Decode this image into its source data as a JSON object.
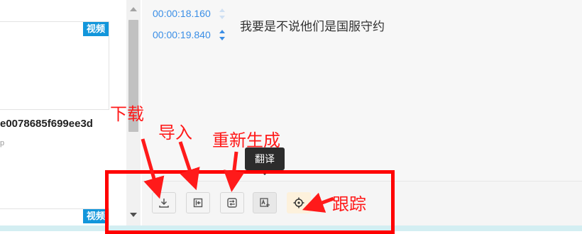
{
  "media_list": {
    "badge": "视频",
    "file_name": "e0078685f699ee3d",
    "sub_text": "p",
    "badge_bottom": "视频"
  },
  "subtitle": {
    "start_time": "00:00:18.160",
    "end_time": "00:00:19.840",
    "text": "我要是不说他们是国服守约"
  },
  "toolbar": {
    "tooltip": "翻译",
    "buttons": [
      {
        "icon": "download-icon"
      },
      {
        "icon": "import-icon"
      },
      {
        "icon": "regenerate-icon"
      },
      {
        "icon": "translate-icon"
      },
      {
        "icon": "target-icon"
      }
    ]
  },
  "annotations": {
    "download": "下载",
    "import": "导入",
    "regenerate": "重新生成",
    "track": "跟踪",
    "box_color": "#ff0000"
  },
  "colors": {
    "accent": "#3a8ee6",
    "badge": "#1296db",
    "annotation": "#ff1a1a"
  }
}
